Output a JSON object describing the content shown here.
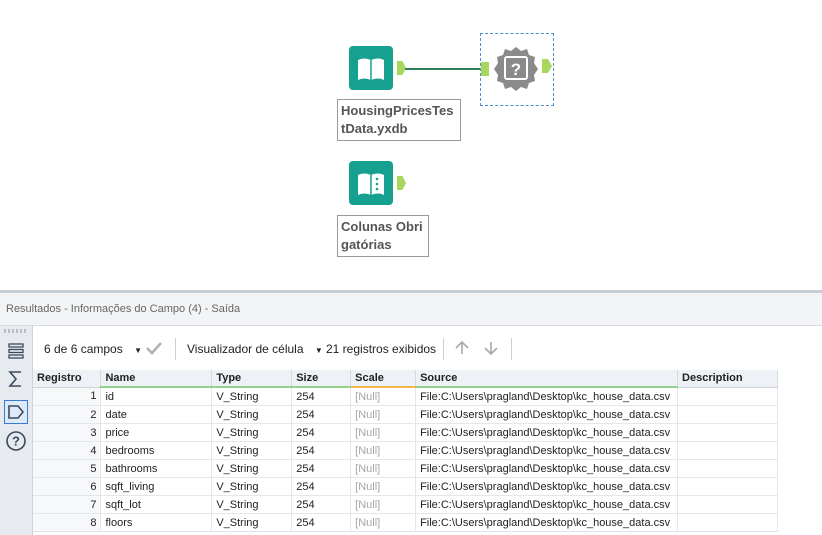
{
  "canvas": {
    "input_tool": {
      "label": "HousingPricesTestData.yxdb",
      "icon": "book-input-icon"
    },
    "text_input_tool": {
      "label": "Colunas Obrigatórias",
      "icon": "book-text-input-icon"
    },
    "browse_tool": {
      "icon": "browse-question-icon"
    }
  },
  "results": {
    "title": "Resultados - Informações do Campo (4) - Saída",
    "toolbar": {
      "fields_label": "6 de 6 campos",
      "viewer_label": "Visualizador de célula",
      "records_label": "21 registros exibidos"
    },
    "columns": [
      "Registro",
      "Name",
      "Type",
      "Size",
      "Scale",
      "Source",
      "Description"
    ],
    "rows": [
      [
        "1",
        "id",
        "V_String",
        "254",
        "[Null]",
        "File:C:\\Users\\pragland\\Desktop\\kc_house_data.csv",
        ""
      ],
      [
        "2",
        "date",
        "V_String",
        "254",
        "[Null]",
        "File:C:\\Users\\pragland\\Desktop\\kc_house_data.csv",
        ""
      ],
      [
        "3",
        "price",
        "V_String",
        "254",
        "[Null]",
        "File:C:\\Users\\pragland\\Desktop\\kc_house_data.csv",
        ""
      ],
      [
        "4",
        "bedrooms",
        "V_String",
        "254",
        "[Null]",
        "File:C:\\Users\\pragland\\Desktop\\kc_house_data.csv",
        ""
      ],
      [
        "5",
        "bathrooms",
        "V_String",
        "254",
        "[Null]",
        "File:C:\\Users\\pragland\\Desktop\\kc_house_data.csv",
        ""
      ],
      [
        "6",
        "sqft_living",
        "V_String",
        "254",
        "[Null]",
        "File:C:\\Users\\pragland\\Desktop\\kc_house_data.csv",
        ""
      ],
      [
        "7",
        "sqft_lot",
        "V_String",
        "254",
        "[Null]",
        "File:C:\\Users\\pragland\\Desktop\\kc_house_data.csv",
        ""
      ],
      [
        "8",
        "floors",
        "V_String",
        "254",
        "[Null]",
        "File:C:\\Users\\pragland\\Desktop\\kc_house_data.csv",
        ""
      ]
    ]
  },
  "colors": {
    "tool_teal": "#16a08f",
    "anchor_green": "#a9d65c",
    "browse_gray": "#8a8a8a",
    "selection_blue": "#4a8fd6"
  }
}
